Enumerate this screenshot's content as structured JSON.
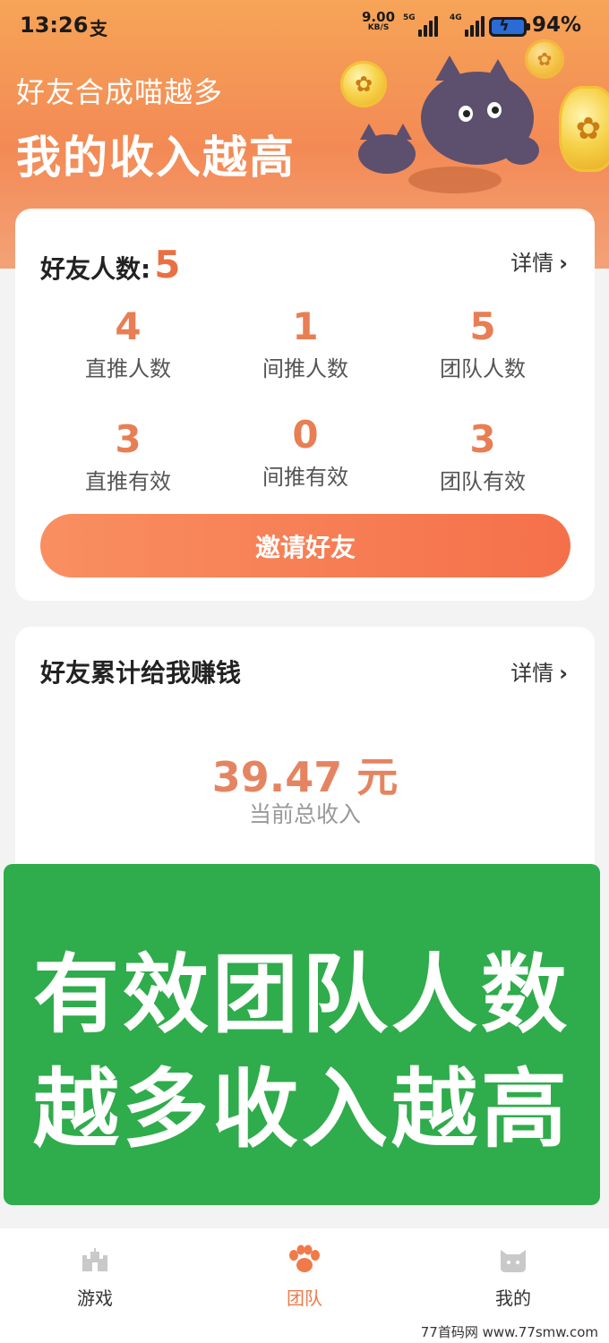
{
  "status_bar": {
    "time": "13:26",
    "app_glyph": "支",
    "net_speed": "9.00",
    "net_unit": "KB/S",
    "sig1_label": "5G",
    "sig2_label": "4G",
    "battery": "94%"
  },
  "hero": {
    "subtitle": "好友合成喵越多",
    "title": "我的收入越高"
  },
  "friends_card": {
    "title": "好友人数:",
    "total": "5",
    "detail": "详情",
    "stats": [
      {
        "value": "4",
        "label": "直推人数"
      },
      {
        "value": "1",
        "label": "间推人数"
      },
      {
        "value": "5",
        "label": "团队人数"
      },
      {
        "value": "3",
        "label": "直推有效"
      },
      {
        "value": "0",
        "label": "间推有效"
      },
      {
        "value": "3",
        "label": "团队有效"
      }
    ],
    "invite_button": "邀请好友"
  },
  "earnings_card": {
    "title": "好友累计给我赚钱",
    "detail": "详情",
    "amount": "39.47 元",
    "amount_label": "当前总收入"
  },
  "banner": {
    "line1": "有效团队人数",
    "line2": "越多收入越高",
    "color": "#2fac4b"
  },
  "tabbar": {
    "tabs": [
      {
        "label": "游戏",
        "icon": "castle-icon"
      },
      {
        "label": "团队",
        "icon": "paw-icon"
      },
      {
        "label": "我的",
        "icon": "cat-face-icon"
      }
    ],
    "active_color": "#f07a4a"
  },
  "watermark": "77首码网 www.77smw.com",
  "colors": {
    "accent": "#ea7043",
    "hero_top": "#f6a457",
    "hero_bottom": "#f38a55"
  }
}
